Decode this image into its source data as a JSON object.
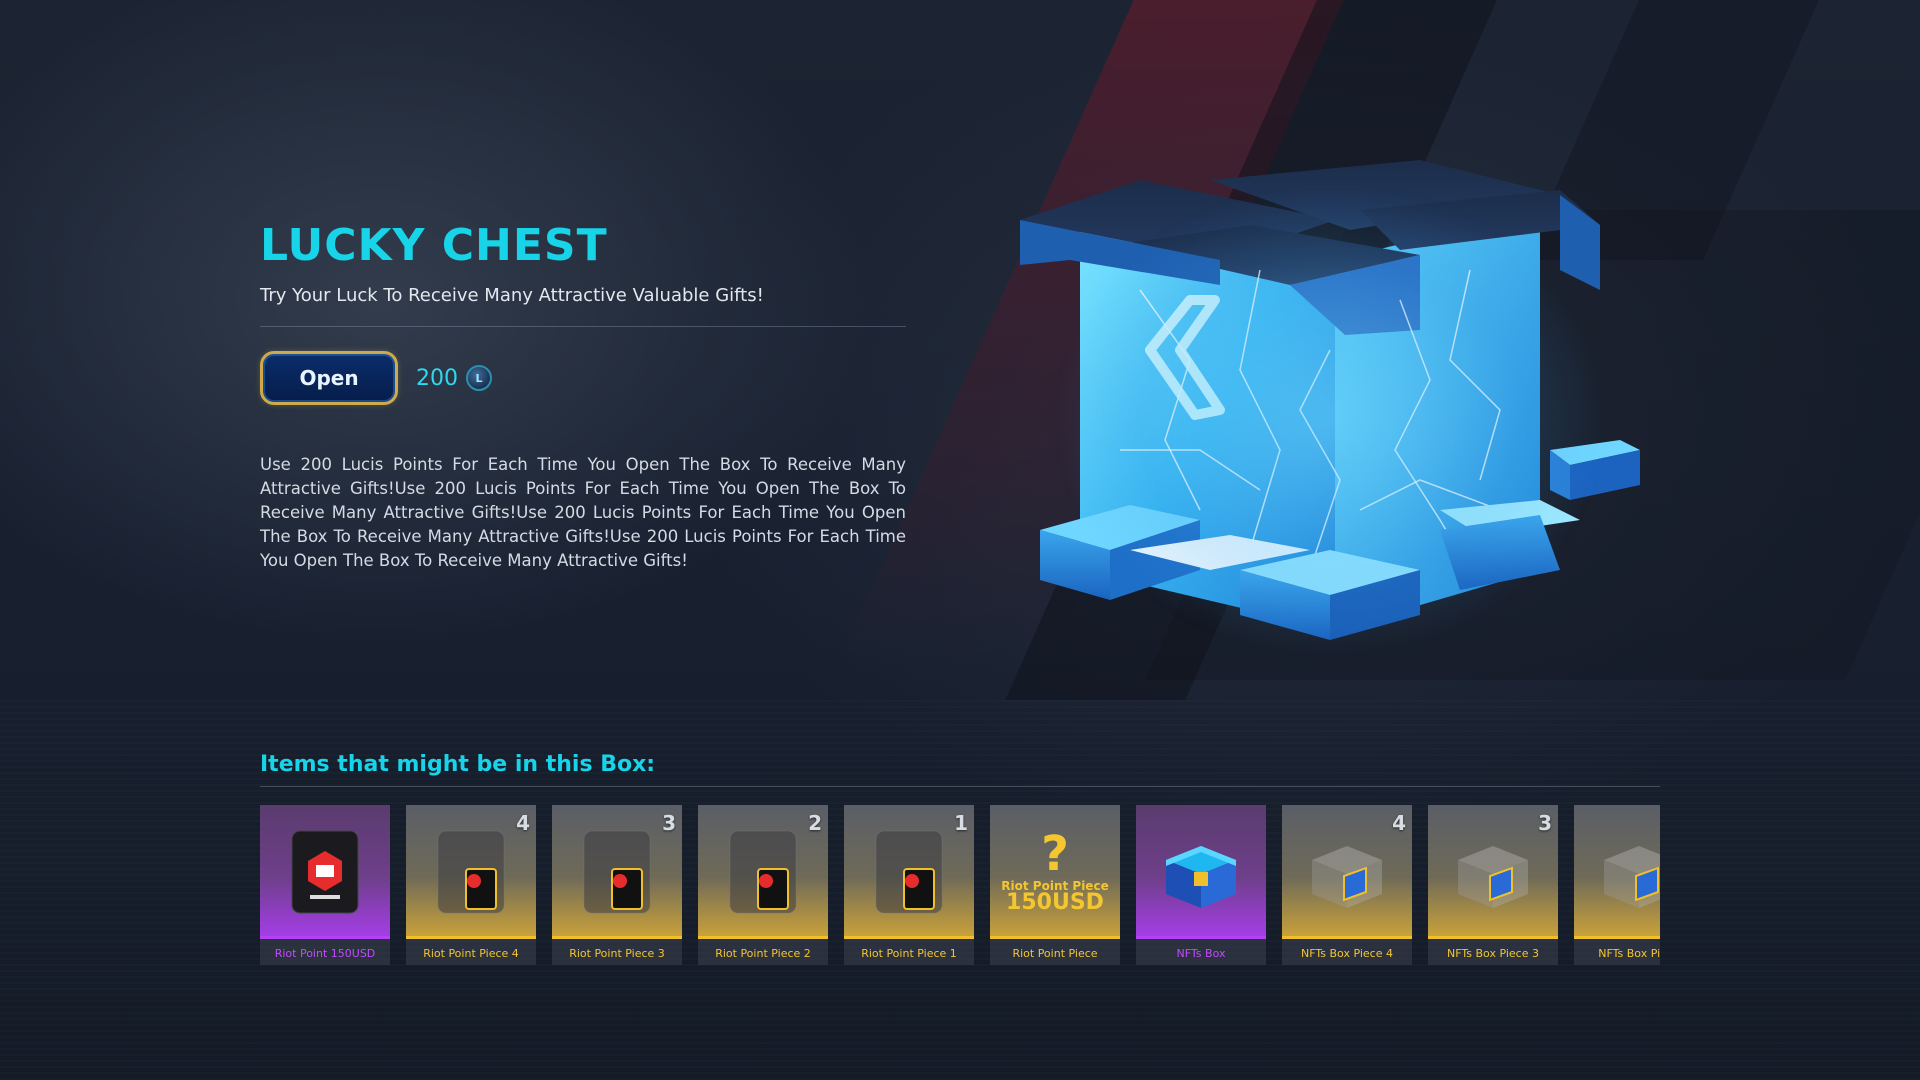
{
  "page": {
    "title": "LUCKY CHEST",
    "subtitle": "Try Your Luck To Receive Many Attractive Valuable Gifts!",
    "open_label": "Open",
    "price": "200",
    "coin_icon": "lucis-coin-icon",
    "description": "Use 200 Lucis Points For Each Time You Open The Box To Receive Many Attractive Gifts!Use 200 Lucis Points For Each Time You Open The Box To Receive Many Attractive Gifts!Use 200 Lucis Points For Each Time You Open The Box To Receive Many Attractive Gifts!Use 200 Lucis Points For Each Time You Open The Box To Receive Many Attractive Gifts!"
  },
  "items_section": {
    "title": "Items that might be in this Box:"
  },
  "items": [
    {
      "label": "Riot Point 150USD",
      "count": "",
      "rarity": "purple",
      "icon": "riot-point-card-icon"
    },
    {
      "label": "Riot Point Piece 4",
      "count": "4",
      "rarity": "gold",
      "icon": "riot-point-piece-icon"
    },
    {
      "label": "Riot Point Piece 3",
      "count": "3",
      "rarity": "gold",
      "icon": "riot-point-piece-icon"
    },
    {
      "label": "Riot Point Piece 2",
      "count": "2",
      "rarity": "gold",
      "icon": "riot-point-piece-icon"
    },
    {
      "label": "Riot Point Piece 1",
      "count": "1",
      "rarity": "gold",
      "icon": "riot-point-piece-icon"
    },
    {
      "label": "Riot Point Piece",
      "count": "",
      "rarity": "gold",
      "icon": "mystery-question-icon",
      "art_line1": "Riot Point Piece",
      "art_line2": "150USD"
    },
    {
      "label": "NFTs Box",
      "count": "",
      "rarity": "purple",
      "icon": "nft-box-icon"
    },
    {
      "label": "NFTs Box Piece 4",
      "count": "4",
      "rarity": "gold",
      "icon": "nft-box-piece-icon"
    },
    {
      "label": "NFTs Box Piece 3",
      "count": "3",
      "rarity": "gold",
      "icon": "nft-box-piece-icon"
    },
    {
      "label": "NFTs Box Piece",
      "count": "",
      "rarity": "gold",
      "icon": "nft-box-piece-icon"
    }
  ],
  "colors": {
    "accent": "#17d4e9",
    "gold": "#f3c632",
    "purple": "#c14bff"
  }
}
